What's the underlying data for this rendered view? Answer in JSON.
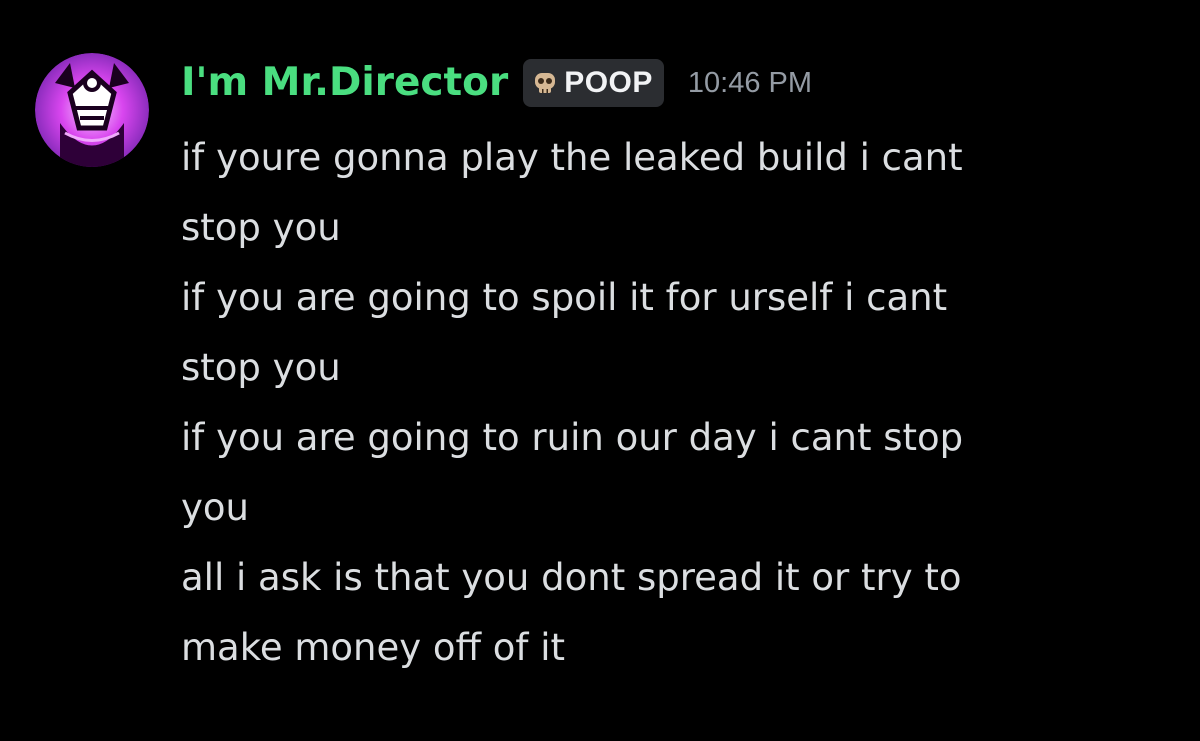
{
  "colors": {
    "username": "#4ade80",
    "text": "#dbdee1",
    "timestamp": "#949ba4",
    "tag_bg": "#2b2d31",
    "avatar_accent": "#c026d3"
  },
  "message": {
    "author": "I'm Mr.Director",
    "tag": {
      "icon": "skull-icon",
      "label": "POOP"
    },
    "timestamp": "10:46 PM",
    "lines": [
      "if youre gonna play the leaked build i cant",
      "stop you",
      "if you are going to spoil it for urself i cant",
      "stop you",
      "if you are going to ruin our day i cant stop",
      "you",
      "all i ask is that you dont spread it or try to",
      "make money off of it"
    ]
  }
}
